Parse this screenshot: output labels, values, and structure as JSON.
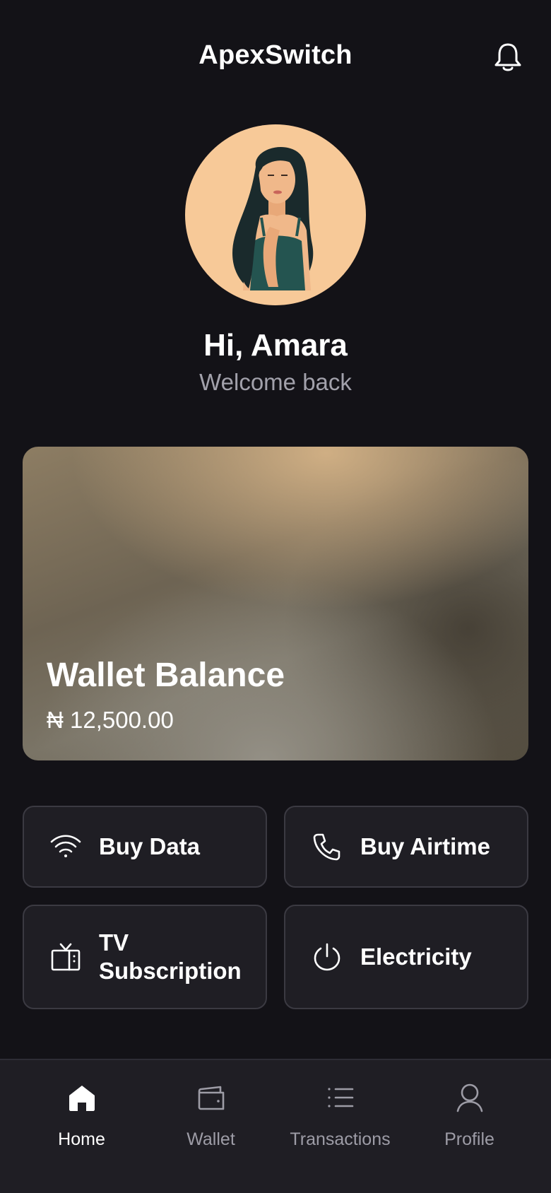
{
  "header": {
    "title": "ApexSwitch",
    "bell_icon": "bell-icon"
  },
  "profile": {
    "greeting": "Hi, Amara",
    "subtitle": "Welcome back"
  },
  "wallet": {
    "label": "Wallet Balance",
    "amount": "₦ 12,500.00"
  },
  "services": [
    {
      "label": "Buy Data",
      "icon": "wifi-icon"
    },
    {
      "label": "Buy Airtime",
      "icon": "phone-icon"
    },
    {
      "label": "TV Subscription",
      "icon": "tv-icon"
    },
    {
      "label": "Electricity",
      "icon": "power-icon"
    }
  ],
  "nav": [
    {
      "label": "Home",
      "icon": "home-icon",
      "active": true
    },
    {
      "label": "Wallet",
      "icon": "wallet-icon",
      "active": false
    },
    {
      "label": "Transactions",
      "icon": "list-icon",
      "active": false
    },
    {
      "label": "Profile",
      "icon": "user-icon",
      "active": false
    }
  ],
  "colors": {
    "background": "#131217",
    "surface": "#1f1e24",
    "border": "#3b3a42",
    "muted_text": "#a2a1ab",
    "avatar_bg": "#f7c998"
  }
}
